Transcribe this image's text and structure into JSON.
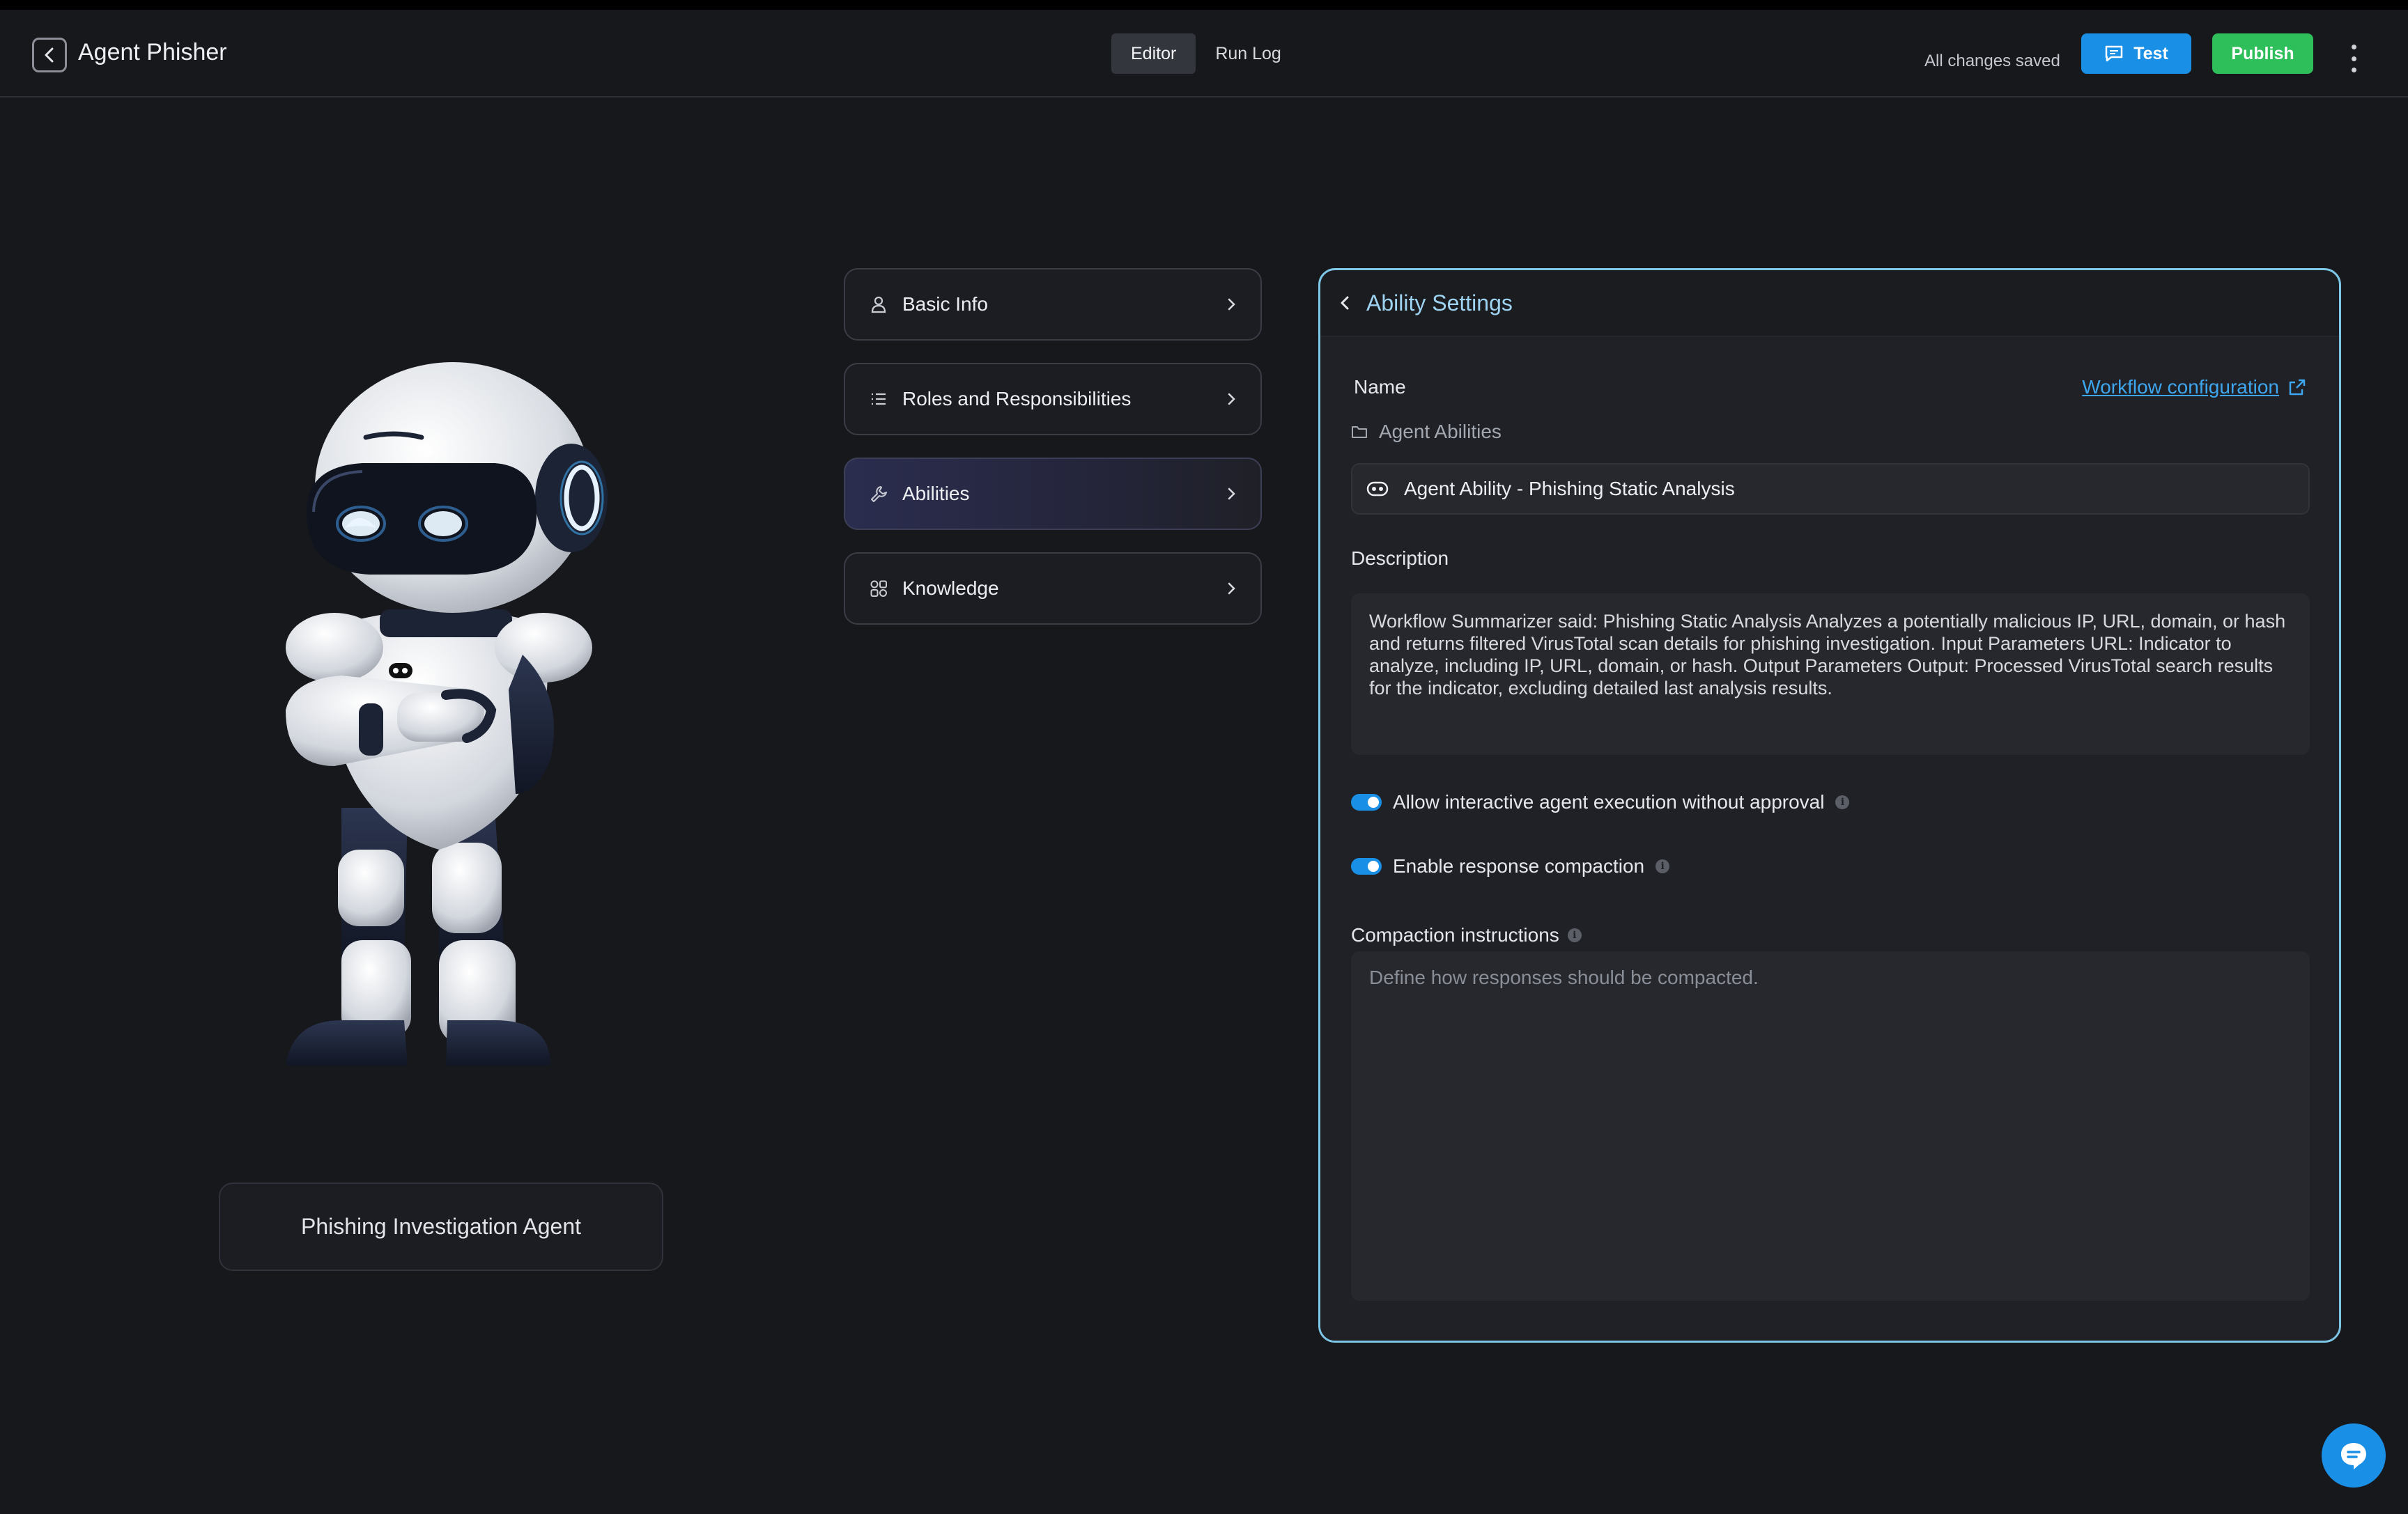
{
  "header": {
    "back_icon": "chevron-left-icon",
    "title": "Agent Phisher",
    "tabs": [
      {
        "label": "Editor",
        "active": true
      },
      {
        "label": "Run Log",
        "active": false
      }
    ],
    "save_status": "All changes saved",
    "test_label": "Test",
    "test_icon": "chat-icon",
    "publish_label": "Publish",
    "more_icon": "kebab-menu-icon",
    "accent_blue": "#1a8fe6",
    "accent_green": "#2fbf5a"
  },
  "agent": {
    "avatar": "robot-icon",
    "name": "Phishing Investigation Agent"
  },
  "menu": {
    "items": [
      {
        "label": "Basic Info",
        "icon": "user-icon"
      },
      {
        "label": "Roles and Responsibilities",
        "icon": "list-icon"
      },
      {
        "label": "Abilities",
        "icon": "wrench-icon",
        "active": true
      },
      {
        "label": "Knowledge",
        "icon": "grid-icon"
      }
    ]
  },
  "ability": {
    "title": "Ability Settings",
    "name_label": "Name",
    "workflow_link": "Workflow configuration",
    "folder": "Agent Abilities",
    "name_value": "Agent Ability - Phishing Static Analysis",
    "description_label": "Description",
    "description": "Workflow Summarizer said: Phishing Static Analysis Analyzes a potentially malicious IP, URL, domain, or hash and returns filtered VirusTotal scan details for phishing investigation. Input Parameters URL: Indicator to analyze, including IP, URL, domain, or hash. Output Parameters Output: Processed VirusTotal search results for the indicator, excluding detailed last analysis results.",
    "toggle_interactive": {
      "label": "Allow interactive agent execution without approval",
      "on": true
    },
    "toggle_compaction": {
      "label": "Enable response compaction",
      "on": true
    },
    "compaction_label": "Compaction instructions",
    "compaction_placeholder": "Define how responses should be compacted.",
    "compaction_value": "",
    "panel_border_color": "#7ec6e6"
  },
  "chat_fab": {
    "icon": "chat-bubble-icon"
  }
}
